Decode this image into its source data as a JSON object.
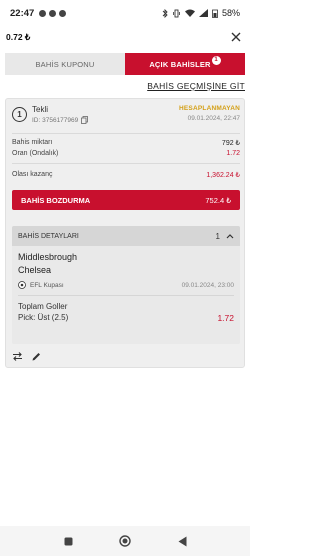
{
  "status_bar": {
    "time": "22:47",
    "battery": "58%"
  },
  "header": {
    "balance": "0.72 ₺"
  },
  "tabs": [
    {
      "label": "BAHİS KUPONU",
      "active": false
    },
    {
      "label": "AÇIK BAHİSLER",
      "active": true,
      "badge": "1"
    }
  ],
  "history_link": "BAHİS GEÇMİŞİNE GİT",
  "bet": {
    "number": "1",
    "type": "Tekli",
    "id_text": "ID: 3756177969",
    "status": "HESAPLANMAYAN",
    "date": "09.01.2024, 22:47",
    "stake_label": "Bahis miktarı",
    "stake_value": "792 ₺",
    "odds_label": "Oran (Ondalık)",
    "odds_value": "1.72",
    "potential_label": "Olası kazanç",
    "potential_value": "1,362.24 ₺",
    "cashout_label": "BAHİS BOZDURMA",
    "cashout_value": "752.4 ₺",
    "details": {
      "title": "BAHİS DETAYLARI",
      "count": "1",
      "home_team": "Middlesbrough",
      "away_team": "Chelsea",
      "league": "EFL Kupası",
      "match_date": "09.01.2024, 23:00",
      "market": "Toplam Goller",
      "pick": "Pick: Üst (2.5)",
      "pick_odds": "1.72"
    }
  },
  "colors": {
    "accent": "#c8102e",
    "status": "#d4a017"
  }
}
